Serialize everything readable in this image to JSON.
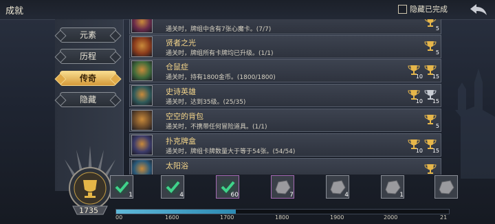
{
  "header": {
    "title": "成就",
    "hide_completed_label": "隐藏已完成"
  },
  "tabs": [
    {
      "label": "元素",
      "active": false
    },
    {
      "label": "历程",
      "active": false
    },
    {
      "label": "传奇",
      "active": true
    },
    {
      "label": "隐藏",
      "active": false
    }
  ],
  "achievements": [
    {
      "name": "",
      "desc": "通关时，牌组中含有7张心魔卡。(7/7)",
      "rewards": [
        {
          "type": "gold",
          "count": "5"
        }
      ]
    },
    {
      "name": "贤者之光",
      "desc": "通关时，牌组所有卡牌均已升级。(1/1)",
      "rewards": [
        {
          "type": "gold",
          "count": "5"
        }
      ]
    },
    {
      "name": "仓鼠症",
      "desc": "通关时，持有1800金币。(1800/1800)",
      "rewards": [
        {
          "type": "gold",
          "count": "10"
        },
        {
          "type": "gold",
          "count": "15"
        }
      ]
    },
    {
      "name": "史诗英雄",
      "desc": "通关时，达到35级。(25/35)",
      "rewards": [
        {
          "type": "gold",
          "count": "10"
        },
        {
          "type": "silver",
          "count": "15"
        }
      ]
    },
    {
      "name": "空空的背包",
      "desc": "通关时，不携带任何冒险道具。(1/1)",
      "rewards": [
        {
          "type": "gold",
          "count": "5"
        }
      ]
    },
    {
      "name": "扑克牌盒",
      "desc": "通关时，牌组卡牌数量大于等于54张。(54/54)",
      "rewards": [
        {
          "type": "gold",
          "count": "10"
        },
        {
          "type": "gold",
          "count": "15"
        }
      ]
    },
    {
      "name": "太阳浴",
      "desc": "",
      "rewards": [
        {
          "type": "gold",
          "count": ""
        }
      ]
    }
  ],
  "trophy_total": "1735",
  "progress": {
    "fraction": 0.36
  },
  "milestones": [
    {
      "count": "1",
      "done": true
    },
    {
      "count": "4",
      "done": true
    },
    {
      "count": "60",
      "done": true
    },
    {
      "count": "7",
      "done": false
    },
    {
      "count": "4",
      "done": false
    },
    {
      "count": "1",
      "done": false
    },
    {
      "count": "",
      "done": false
    }
  ],
  "ticks": [
    "00",
    "1600",
    "1700",
    "1800",
    "1900",
    "2000",
    "21"
  ]
}
